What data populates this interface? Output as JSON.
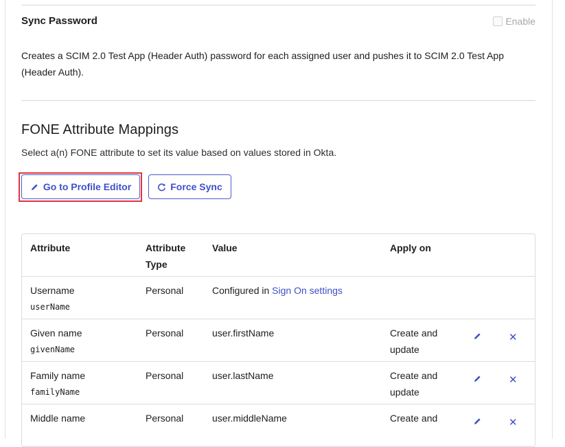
{
  "sync_password": {
    "title": "Sync Password",
    "enable_label": "Enable",
    "description": "Creates a SCIM 2.0 Test App (Header Auth) password for each assigned user and pushes it to SCIM 2.0 Test App (Header Auth)."
  },
  "mappings": {
    "title": "FONE Attribute Mappings",
    "description": "Select a(n) FONE attribute to set its value based on values stored in Okta.",
    "profile_editor_label": "Go to Profile Editor",
    "force_sync_label": "Force Sync"
  },
  "table": {
    "headers": [
      "Attribute",
      "Attribute Type",
      "Value",
      "Apply on"
    ],
    "rows": [
      {
        "name": "Username",
        "var": "userName",
        "type": "Personal",
        "value_prefix": "Configured in ",
        "value_link": "Sign On settings",
        "apply": ""
      },
      {
        "name": "Given name",
        "var": "givenName",
        "type": "Personal",
        "value": "user.firstName",
        "apply": "Create and update"
      },
      {
        "name": "Family name",
        "var": "familyName",
        "type": "Personal",
        "value": "user.lastName",
        "apply": "Create and update"
      },
      {
        "name": "Middle name",
        "var": "",
        "type": "Personal",
        "value": "user.middleName",
        "apply": "Create and"
      }
    ]
  },
  "colors": {
    "accent": "#3f4fc8",
    "highlight": "#e0343f"
  }
}
